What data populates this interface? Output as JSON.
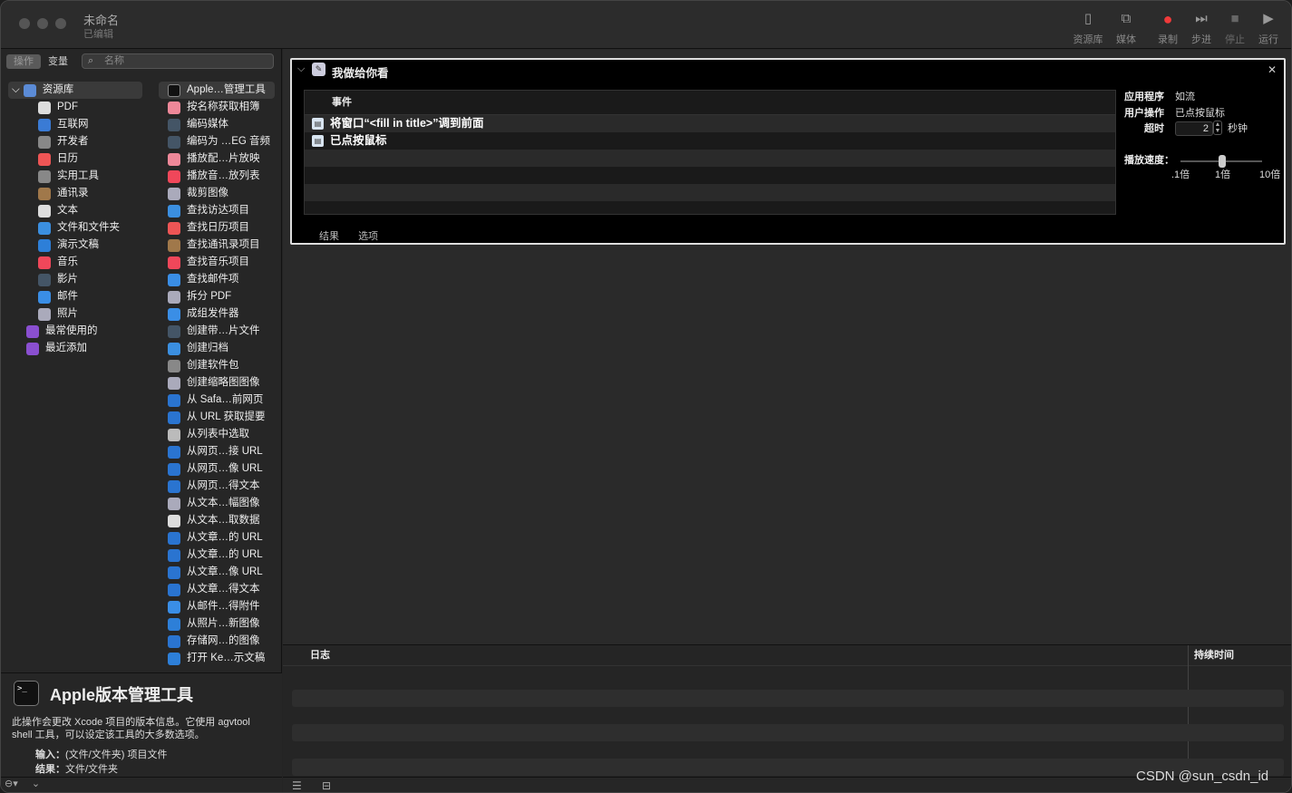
{
  "window": {
    "title": "未命名",
    "subtitle": "已编辑"
  },
  "toolbar": {
    "library": "资源库",
    "media": "媒体",
    "record": "录制",
    "step": "步进",
    "stop": "停止",
    "run": "运行"
  },
  "sidebar": {
    "tab_actions": "操作",
    "tab_variables": "变量",
    "search_placeholder": "名称",
    "categories": [
      {
        "label": "资源库",
        "icon": "library-icon",
        "color": "#5b8bd6"
      },
      {
        "label": "PDF",
        "icon": "pdf-icon",
        "color": "#ddd"
      },
      {
        "label": "互联网",
        "icon": "globe-icon",
        "color": "#3a7bd5"
      },
      {
        "label": "开发者",
        "icon": "tools-icon",
        "color": "#888"
      },
      {
        "label": "日历",
        "icon": "calendar-icon",
        "color": "#e55"
      },
      {
        "label": "实用工具",
        "icon": "tools-icon",
        "color": "#888"
      },
      {
        "label": "通讯录",
        "icon": "contacts-icon",
        "color": "#a0784a"
      },
      {
        "label": "文本",
        "icon": "text-icon",
        "color": "#ddd"
      },
      {
        "label": "文件和文件夹",
        "icon": "finder-icon",
        "color": "#3b8fe0"
      },
      {
        "label": "演示文稿",
        "icon": "keynote-icon",
        "color": "#2d7fd8"
      },
      {
        "label": "音乐",
        "icon": "music-icon",
        "color": "#f0475a"
      },
      {
        "label": "影片",
        "icon": "quicktime-icon",
        "color": "#456"
      },
      {
        "label": "邮件",
        "icon": "mail-icon",
        "color": "#3a8ee6"
      },
      {
        "label": "照片",
        "icon": "photos-icon",
        "color": "#aab"
      },
      {
        "label": "最常使用的",
        "icon": "smart-folder-icon",
        "color": "#8a4fd0"
      },
      {
        "label": "最近添加",
        "icon": "smart-folder-icon",
        "color": "#8a4fd0"
      }
    ],
    "actions": [
      {
        "label": "Apple…管理工具",
        "color": "#111"
      },
      {
        "label": "按名称获取相簿",
        "color": "#e89"
      },
      {
        "label": "编码媒体",
        "color": "#456"
      },
      {
        "label": "编码为 …EG 音频",
        "color": "#456"
      },
      {
        "label": "播放配…片放映",
        "color": "#e89"
      },
      {
        "label": "播放音…放列表",
        "color": "#f0475a"
      },
      {
        "label": "裁剪图像",
        "color": "#aab"
      },
      {
        "label": "查找访达项目",
        "color": "#3b8fe0"
      },
      {
        "label": "查找日历项目",
        "color": "#e55"
      },
      {
        "label": "查找通讯录项目",
        "color": "#a0784a"
      },
      {
        "label": "查找音乐项目",
        "color": "#f0475a"
      },
      {
        "label": "查找邮件项",
        "color": "#3a8ee6"
      },
      {
        "label": "拆分 PDF",
        "color": "#aab"
      },
      {
        "label": "成组发件器",
        "color": "#3a8ee6"
      },
      {
        "label": "创建带…片文件",
        "color": "#456"
      },
      {
        "label": "创建归档",
        "color": "#3b8fe0"
      },
      {
        "label": "创建软件包",
        "color": "#888"
      },
      {
        "label": "创建缩略图图像",
        "color": "#aab"
      },
      {
        "label": "从 Safa…前网页",
        "color": "#2a74d0"
      },
      {
        "label": "从 URL 获取提要",
        "color": "#2a74d0"
      },
      {
        "label": "从列表中选取",
        "color": "#bbb"
      },
      {
        "label": "从网页…接 URL",
        "color": "#2a74d0"
      },
      {
        "label": "从网页…像 URL",
        "color": "#2a74d0"
      },
      {
        "label": "从网页…得文本",
        "color": "#2a74d0"
      },
      {
        "label": "从文本…幅图像",
        "color": "#aab"
      },
      {
        "label": "从文本…取数据",
        "color": "#ddd"
      },
      {
        "label": "从文章…的 URL",
        "color": "#2a74d0"
      },
      {
        "label": "从文章…的 URL",
        "color": "#2a74d0"
      },
      {
        "label": "从文章…像 URL",
        "color": "#2a74d0"
      },
      {
        "label": "从文章…得文本",
        "color": "#2a74d0"
      },
      {
        "label": "从邮件…得附件",
        "color": "#3a8ee6"
      },
      {
        "label": "从照片…新图像",
        "color": "#2d7fd8"
      },
      {
        "label": "存储网…的图像",
        "color": "#2a74d0"
      },
      {
        "label": "打开 Ke…示文稿",
        "color": "#2d7fd8"
      }
    ]
  },
  "description": {
    "title": "Apple版本管理工具",
    "text": "此操作会更改 Xcode 项目的版本信息。它使用 agvtool shell 工具，可以设定该工具的大多数选项。",
    "input_label": "输入：",
    "input_value": "(文件/文件夹) 项目文件",
    "result_label": "结果：",
    "result_value": "文件/文件夹"
  },
  "action": {
    "title": "我做给你看",
    "events_header": "事件",
    "events": [
      "将窗口“<fill in title>”调到前面",
      "已点按鼠标"
    ],
    "tab_results": "结果",
    "tab_options": "选项",
    "app_label": "应用程序",
    "app_value": "如流",
    "user_action_label": "用户操作",
    "user_action_value": "已点按鼠标",
    "timeout_label": "超时",
    "timeout_value": "2",
    "timeout_unit": "秒钟",
    "speed_label": "播放速度：",
    "speed_ticks": [
      ".1倍",
      "1倍",
      "10倍"
    ]
  },
  "log": {
    "col_log": "日志",
    "col_duration": "持续时间"
  },
  "watermark": "CSDN @sun_csdn_id"
}
